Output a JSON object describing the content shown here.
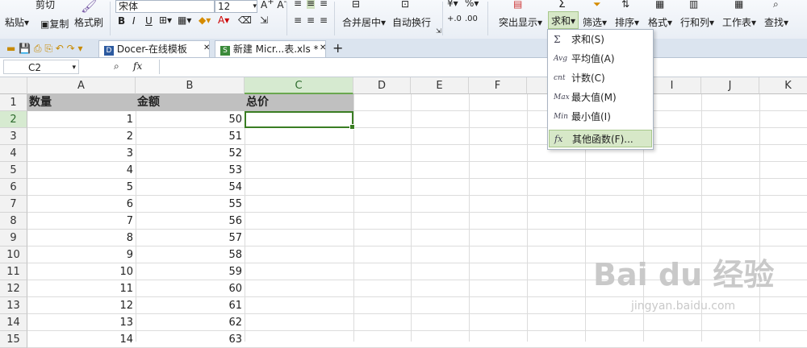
{
  "toolbar": {
    "cut": "剪切",
    "paste": "粘贴",
    "copy": "复制",
    "format_painter": "格式刷",
    "font_name": "宋体",
    "font_size": "12",
    "bold": "B",
    "italic": "I",
    "underline": "U",
    "merge_center": "合并居中",
    "wrap_text": "自动换行",
    "percent": "%",
    "highlight": "突出显示",
    "sum": "求和",
    "filter": "筛选",
    "sort": "排序",
    "format": "格式",
    "rows_cols": "行和列",
    "worksheet": "工作表",
    "find": "查找"
  },
  "tabs": [
    {
      "label": "Docer-在线模板"
    },
    {
      "label": "新建 Micr...表.xls *"
    }
  ],
  "formula_bar": {
    "name_box": "C2",
    "fx": "fx",
    "value": ""
  },
  "columns": [
    "A",
    "B",
    "C",
    "D",
    "E",
    "F",
    "G",
    "H",
    "I",
    "J",
    "K"
  ],
  "rows": [
    "1",
    "2",
    "3",
    "4",
    "5",
    "6",
    "7",
    "8",
    "9",
    "10",
    "11",
    "12",
    "13",
    "14",
    "15"
  ],
  "headers": {
    "a": "数量",
    "b": "金额",
    "c": "总价"
  },
  "data": [
    {
      "a": "1",
      "b": "50"
    },
    {
      "a": "2",
      "b": "51"
    },
    {
      "a": "3",
      "b": "52"
    },
    {
      "a": "4",
      "b": "53"
    },
    {
      "a": "5",
      "b": "54"
    },
    {
      "a": "6",
      "b": "55"
    },
    {
      "a": "7",
      "b": "56"
    },
    {
      "a": "8",
      "b": "57"
    },
    {
      "a": "9",
      "b": "58"
    },
    {
      "a": "10",
      "b": "59"
    },
    {
      "a": "11",
      "b": "60"
    },
    {
      "a": "12",
      "b": "61"
    },
    {
      "a": "13",
      "b": "62"
    },
    {
      "a": "14",
      "b": "63"
    }
  ],
  "sum_menu": {
    "items": [
      {
        "icon": "Σ",
        "label": "求和(S)"
      },
      {
        "icon": "Avg",
        "label": "平均值(A)"
      },
      {
        "icon": "cnt",
        "label": "计数(C)"
      },
      {
        "icon": "Max",
        "label": "最大值(M)"
      },
      {
        "icon": "Min",
        "label": "最小值(I)"
      },
      {
        "icon": "fx",
        "label": "其他函数(F)..."
      }
    ]
  },
  "watermark": {
    "main": "Bai du 经验",
    "sub": "jingyan.baidu.com"
  },
  "colors": {
    "selection_green": "#3a7d23",
    "header_gray": "#c0c0c0",
    "menu_highlight": "#d7e8c8"
  }
}
